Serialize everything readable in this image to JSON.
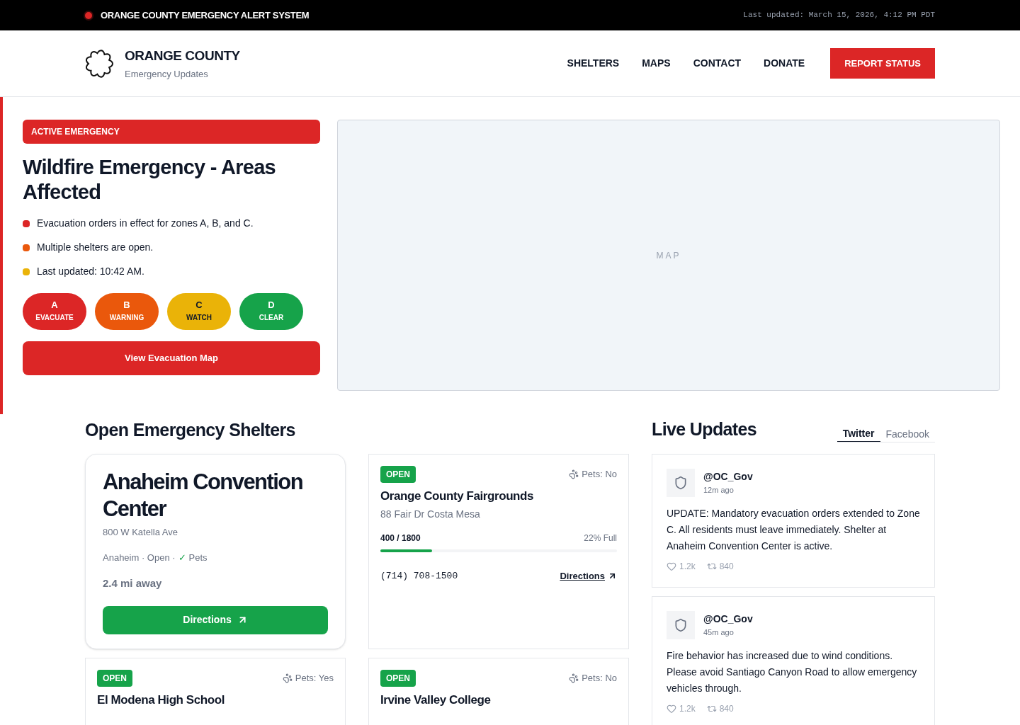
{
  "alert_bar": {
    "title": "ORANGE COUNTY EMERGENCY ALERT SYSTEM",
    "updated": "Last updated: March 15, 2026, 4:12 PM PDT"
  },
  "header": {
    "logo_title": "ORANGE COUNTY",
    "logo_subtitle": "Emergency Updates",
    "nav": [
      "SHELTERS",
      "MAPS",
      "CONTACT",
      "DONATE"
    ],
    "cta": "REPORT STATUS"
  },
  "emergency": {
    "badge": "ACTIVE EMERGENCY",
    "title": "Wildfire Emergency - Areas Affected",
    "bullets": [
      {
        "text": "Evacuation orders in effect for zones A, B, and C.",
        "color": "#dc2626"
      },
      {
        "text": "Multiple shelters are open.",
        "color": "#ea580c"
      },
      {
        "text": "Last updated: 10:42 AM.",
        "color": "#eab308"
      }
    ],
    "zones": [
      {
        "letter": "A",
        "label": "EVACUATE",
        "color": "#dc2626"
      },
      {
        "letter": "B",
        "label": "WARNING",
        "color": "#ea580c"
      },
      {
        "letter": "C",
        "label": "WATCH",
        "color": "#eab308"
      },
      {
        "letter": "D",
        "label": "CLEAR",
        "color": "#16a34a"
      }
    ],
    "map_button": "View Evacuation Map"
  },
  "map": {
    "label": "MAP"
  },
  "shelters": {
    "title": "Open Emergency Shelters",
    "featured": {
      "name": "Anaheim Convention Center",
      "address": "800 W Katella Ave",
      "meta": "Anaheim · Open ·",
      "pets_mark": "✓",
      "pets_label": "Pets",
      "distance": "2.4 mi away",
      "button": "Directions"
    },
    "cards": [
      {
        "status": "OPEN",
        "pets": "Pets: No",
        "name": "Orange County Fairgrounds",
        "address": "88 Fair Dr Costa Mesa",
        "occupancy": "400 / 1800",
        "percent": "22% Full",
        "level": 0.22,
        "phone": "(714) 708-1500",
        "directions": "Directions"
      },
      {
        "status": "OPEN",
        "pets": "Pets: Yes",
        "name": "El Modena High School"
      },
      {
        "status": "OPEN",
        "pets": "Pets: No",
        "name": "Irvine Valley College"
      }
    ]
  },
  "updates": {
    "title": "Live Updates",
    "tabs": [
      {
        "label": "Twitter",
        "selected": true
      },
      {
        "label": "Facebook",
        "selected": false
      }
    ],
    "posts": [
      {
        "handle": "@OC_Gov",
        "time": "12m ago",
        "text": "UPDATE: Mandatory evacuation orders extended to Zone C. All residents must leave immediately. Shelter at Anaheim Convention Center is active.",
        "likes": "1.2k",
        "reposts": "840"
      },
      {
        "handle": "@OC_Gov",
        "time": "45m ago",
        "text": "Fire behavior has increased due to wind conditions. Please avoid Santiago Canyon Road to allow emergency vehicles through.",
        "likes": "1.2k",
        "reposts": "840"
      }
    ]
  }
}
